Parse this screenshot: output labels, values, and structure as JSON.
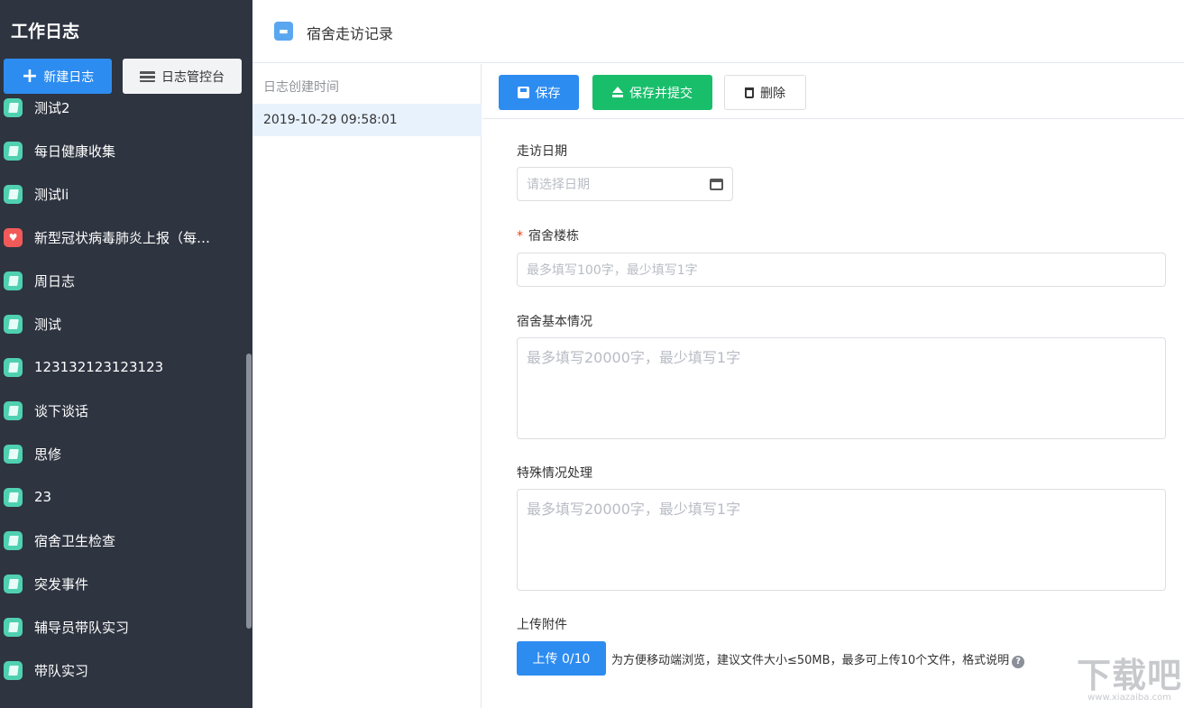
{
  "sidebar": {
    "title": "工作日志",
    "new_button": "新建日志",
    "console_button": "日志管控台",
    "items": [
      {
        "label": "测试2",
        "icon": "book-icon",
        "color": "#4fd1b1"
      },
      {
        "label": "每日健康收集",
        "icon": "book-icon",
        "color": "#4fd1b1"
      },
      {
        "label": "测试li",
        "icon": "book-icon",
        "color": "#4fd1b1"
      },
      {
        "label": "新型冠状病毒肺炎上报（每…",
        "icon": "heart-icon",
        "color": "#f25a5a"
      },
      {
        "label": "周日志",
        "icon": "book-icon",
        "color": "#4fd1b1"
      },
      {
        "label": "测试",
        "icon": "book-icon",
        "color": "#4fd1b1"
      },
      {
        "label": "123132123123123",
        "icon": "book-icon",
        "color": "#4fd1b1"
      },
      {
        "label": "谈下谈话",
        "icon": "book-icon",
        "color": "#4fd1b1"
      },
      {
        "label": "思修",
        "icon": "book-icon",
        "color": "#4fd1b1"
      },
      {
        "label": "23",
        "icon": "book-icon",
        "color": "#4fd1b1"
      },
      {
        "label": "宿舍卫生检查",
        "icon": "book-icon",
        "color": "#4fd1b1"
      },
      {
        "label": "突发事件",
        "icon": "book-icon",
        "color": "#4fd1b1"
      },
      {
        "label": "辅导员带队实习",
        "icon": "book-icon",
        "color": "#4fd1b1"
      },
      {
        "label": "带队实习",
        "icon": "book-icon",
        "color": "#4fd1b1"
      }
    ]
  },
  "header": {
    "title": "宿舍走访记录",
    "icon": "bed-icon"
  },
  "list": {
    "column_header": "日志创建时间",
    "rows": [
      "2019-10-29 09:58:01"
    ]
  },
  "toolbar": {
    "save_label": "保存",
    "submit_label": "保存并提交",
    "delete_label": "删除"
  },
  "form": {
    "visit_date": {
      "label": "走访日期",
      "placeholder": "请选择日期"
    },
    "building": {
      "label": "宿舍楼栋",
      "required_mark": "*",
      "placeholder": "最多填写100字，最少填写1字"
    },
    "basic_info": {
      "label": "宿舍基本情况",
      "placeholder": "最多填写20000字，最少填写1字"
    },
    "special": {
      "label": "特殊情况处理",
      "placeholder": "最多填写20000字，最少填写1字"
    },
    "upload": {
      "label": "上传附件",
      "button": "上传 0/10",
      "hint": "为方便移动端浏览，建议文件大小≤50MB，最多可上传10个文件，格式说明",
      "help": "?"
    }
  },
  "watermark": {
    "main": "下载吧",
    "sub": "www.xiazaiba.com"
  },
  "colors": {
    "sidebar_bg": "#2e3440",
    "primary": "#2d8cf0",
    "success": "#19be6b",
    "selected_row": "#e8f2fd"
  }
}
